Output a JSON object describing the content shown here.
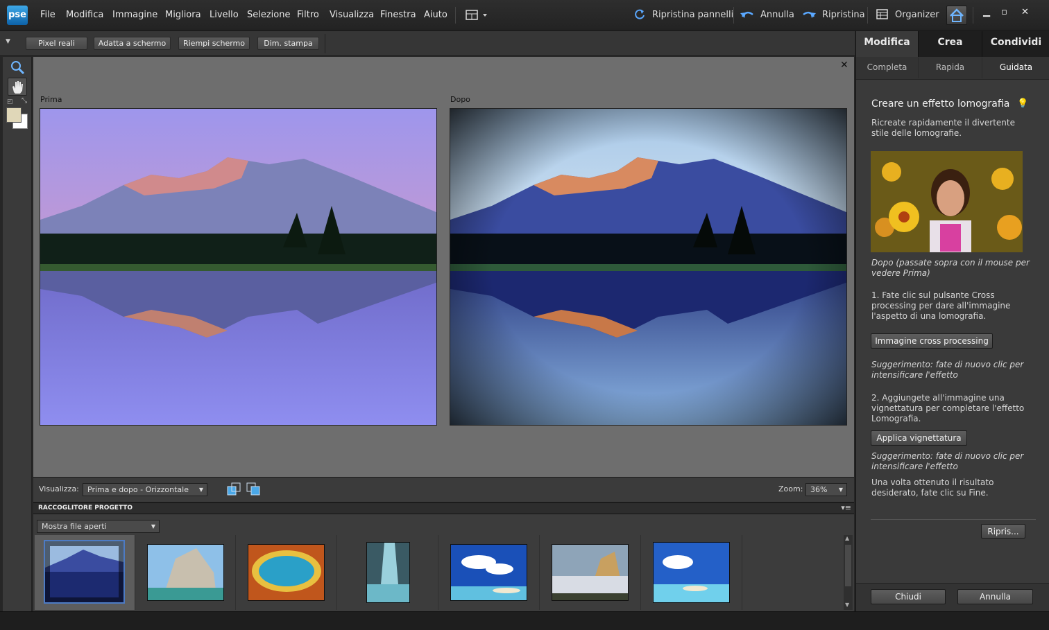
{
  "app": {
    "logo": "pse"
  },
  "menu": [
    "File",
    "Modifica",
    "Immagine",
    "Migliora",
    "Livello",
    "Selezione",
    "Filtro",
    "Visualizza",
    "Finestra",
    "Aiuto"
  ],
  "topright": {
    "reset_panels": "Ripristina pannelli",
    "undo": "Annulla",
    "redo": "Ripristina",
    "organizer": "Organizer"
  },
  "options": {
    "btn1": "Pixel reali",
    "btn2": "Adatta a schermo",
    "btn3": "Riempi schermo",
    "btn4": "Dim. stampa"
  },
  "canvas": {
    "before_label": "Prima",
    "after_label": "Dopo",
    "close": "✕"
  },
  "viewbar": {
    "label": "Visualizza:",
    "mode": "Prima e dopo - Orizzontale",
    "zoom_label": "Zoom:",
    "zoom_value": "36%"
  },
  "bin": {
    "title": "RACCOGLITORE PROGETTO",
    "filter": "Mostra file aperti"
  },
  "panel": {
    "tabs": [
      "Modifica",
      "Crea",
      "Condividi"
    ],
    "subtabs": [
      "Completa",
      "Rapida",
      "Guidata"
    ],
    "title": "Creare un effetto lomografia",
    "intro": "Ricreate rapidamente il divertente stile delle lomografie.",
    "caption": "Dopo (passate sopra con il mouse per vedere Prima)",
    "step1": "1. Fate clic sul pulsante Cross processing per dare all'immagine l'aspetto di una lomografia.",
    "btn_cross": "Immagine cross processing",
    "hint1": "Suggerimento: fate di nuovo clic per intensificare l'effetto",
    "step2": "2. Aggiungete all'immagine una vignettatura per completare l'effetto Lomografia.",
    "btn_vignette": "Applica vignettatura",
    "hint2": "Suggerimento: fate di nuovo clic per intensificare l'effetto",
    "outro": "Una volta ottenuto il risultato desiderato, fate clic su Fine.",
    "btn_reset": "Ripris...",
    "btn_close": "Chiudi",
    "btn_cancel": "Annulla"
  },
  "colors": {
    "accent": "#0d62a8",
    "active_tab": "#3a3a3a",
    "selected_thumb": "#4d7bc4"
  }
}
